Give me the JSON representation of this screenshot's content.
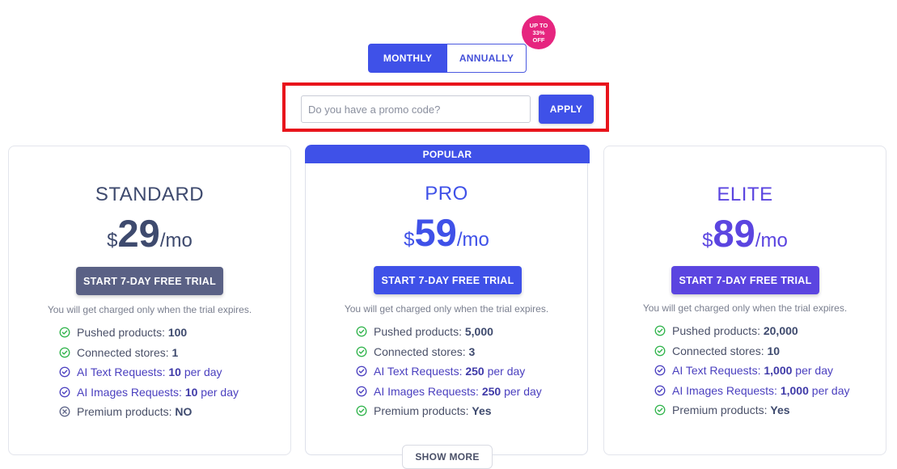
{
  "billing_toggle": {
    "monthly": "MONTHLY",
    "annually": "ANNUALLY"
  },
  "discount_badge": {
    "line1": "UP TO",
    "line2": "33%",
    "line3": "OFF"
  },
  "promo": {
    "placeholder": "Do you have a promo code?",
    "value": "",
    "apply_label": "APPLY"
  },
  "popular_label": "POPULAR",
  "show_more_label": "SHOW MORE",
  "colors": {
    "primary": "#3f51e8",
    "elite": "#5b45e0",
    "standard_button": "#5a6185",
    "badge": "#e6257f",
    "highlight": "#e8141b"
  },
  "plans": [
    {
      "name": "STANDARD",
      "currency": "$",
      "amount": "29",
      "period": "/mo",
      "cta": "START 7-DAY FREE TRIAL",
      "note": "You will get charged only when the trial expires.",
      "features": [
        {
          "icon": "check-circle-icon",
          "label": "Pushed products: ",
          "value": "100",
          "unit": ""
        },
        {
          "icon": "check-circle-icon",
          "label": "Connected stores: ",
          "value": "1",
          "unit": ""
        },
        {
          "icon": "ai-check-circle-icon",
          "label": "AI Text Requests: ",
          "value": "10",
          "unit": " per day"
        },
        {
          "icon": "ai-check-circle-icon",
          "label": "AI Images Requests: ",
          "value": "10",
          "unit": " per day"
        },
        {
          "icon": "x-circle-icon",
          "label": "Premium products: ",
          "value": "NO",
          "unit": ""
        }
      ]
    },
    {
      "name": "PRO",
      "currency": "$",
      "amount": "59",
      "period": "/mo",
      "cta": "START 7-DAY FREE TRIAL",
      "note": "You will get charged only when the trial expires.",
      "features": [
        {
          "icon": "check-circle-icon",
          "label": "Pushed products: ",
          "value": "5,000",
          "unit": ""
        },
        {
          "icon": "check-circle-icon",
          "label": "Connected stores: ",
          "value": "3",
          "unit": ""
        },
        {
          "icon": "ai-check-circle-icon",
          "label": "AI Text Requests: ",
          "value": "250",
          "unit": " per day"
        },
        {
          "icon": "ai-check-circle-icon",
          "label": "AI Images Requests: ",
          "value": "250",
          "unit": " per day"
        },
        {
          "icon": "check-circle-icon",
          "label": "Premium products: ",
          "value": "Yes",
          "unit": ""
        }
      ]
    },
    {
      "name": "ELITE",
      "currency": "$",
      "amount": "89",
      "period": "/mo",
      "cta": "START 7-DAY FREE TRIAL",
      "note": "You will get charged only when the trial expires.",
      "features": [
        {
          "icon": "check-circle-icon",
          "label": "Pushed products: ",
          "value": "20,000",
          "unit": ""
        },
        {
          "icon": "check-circle-icon",
          "label": "Connected stores: ",
          "value": "10",
          "unit": ""
        },
        {
          "icon": "ai-check-circle-icon",
          "label": "AI Text Requests: ",
          "value": "1,000",
          "unit": " per day"
        },
        {
          "icon": "ai-check-circle-icon",
          "label": "AI Images Requests: ",
          "value": "1,000",
          "unit": " per day"
        },
        {
          "icon": "check-circle-icon",
          "label": "Premium products: ",
          "value": "Yes",
          "unit": ""
        }
      ]
    }
  ]
}
